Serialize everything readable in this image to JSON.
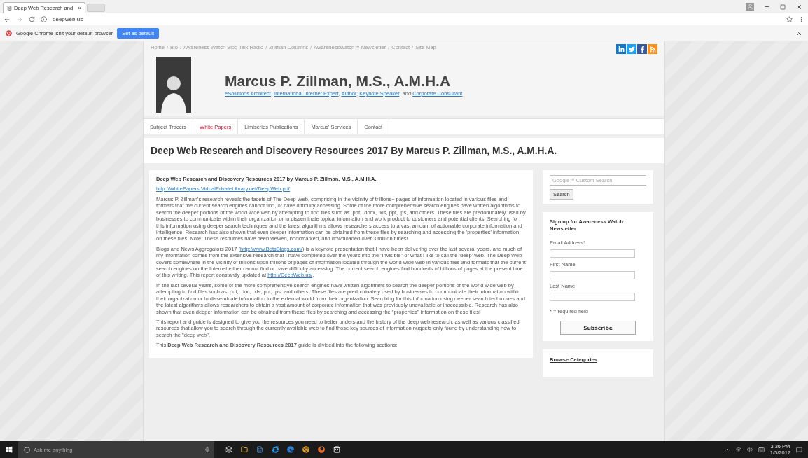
{
  "browser": {
    "tabs": [
      {
        "title": "Deep Web Research and",
        "close": "×",
        "selected": true
      }
    ],
    "address": "deepweb.us",
    "infobar": {
      "message": "Google Chrome isn't your default browser",
      "button": "Set as default"
    }
  },
  "site": {
    "top_links": {
      "separator": "/",
      "items": [
        "Home",
        "Bio",
        "Awareness Watch Blog Talk Radio",
        "Zillman Columns",
        "AwarenessWatch™ Newsletter",
        "Contact",
        "Site Map"
      ]
    },
    "name": "Marcus P. Zillman, M.S., A.M.H.A",
    "tagline": [
      {
        "kind": "link",
        "text": "eSolutions Architect"
      },
      {
        "kind": "text",
        "text": ", "
      },
      {
        "kind": "link",
        "text": "International Internet Expert"
      },
      {
        "kind": "text",
        "text": ", "
      },
      {
        "kind": "link",
        "text": "Author"
      },
      {
        "kind": "text",
        "text": ", "
      },
      {
        "kind": "link",
        "text": "Keynote Speaker"
      },
      {
        "kind": "text",
        "text": ", and "
      },
      {
        "kind": "link",
        "text": "Corporate Consultant"
      }
    ],
    "nav": [
      {
        "label": "Subject Tracers",
        "selected": false
      },
      {
        "label": "White Papers",
        "selected": true
      },
      {
        "label": "Limiseries Publications",
        "selected": false
      },
      {
        "label": "Marcus' Services",
        "selected": false
      },
      {
        "label": "Contact",
        "selected": false
      }
    ],
    "page_title": "Deep Web Research and Discovery Resources 2017 By Marcus P. Zillman, M.S., A.M.H.A."
  },
  "article": {
    "heading": "Deep Web Research and Discovery Resources 2017 by Marcus P. Zillman, M.S., A.M.H.A.",
    "link": "http://WhitePapers.VirtualPrivateLibrary.net/DeepWeb.pdf",
    "paragraphs": [
      [
        {
          "kind": "text",
          "text": "Marcus P. Zillman's research reveals the facets of The Deep Web, comprising in the  vicinity of trillions+ pages of information located in various files and formats that the current search engines cannot find, or have difficulty accessing. Some of the more comprehensive search engines have written algorithms to search the deeper portions of the world wide web by attempting to find files such as .pdf, .docx, .xls, ppt, .ps, and others. These files are predominately used by businesses to communicate within their organization or to disseminate topical information and work product to customers and potential clients. Searching for this information using deeper search techniques and the latest algorithms allows researchers access to a vast amount of actionable corporate information and intelligence. Research has also shown that even deeper information can be obtained from these files by searching and accessing the 'properties' information on these files.  Note: These resources have been viewed, bookmarked, and downloaded over 3 million times!"
        }
      ],
      [
        {
          "kind": "text",
          "text": "Blogs and News Aggregators 2017 ("
        },
        {
          "kind": "link",
          "text": "http://www.BotsBlogs.com/"
        },
        {
          "kind": "text",
          "text": ") is a keynote presentation that I have been delivering over the last several years, and much of my information comes from the extensive research that I have completed over the years into the \"invisible\" or what I like to call the 'deep' web. The Deep Web covers somewhere in the vicinity of trillions upon trillions of pages of information located through the world wide web in various files and formats that the current search engines on the Internet either cannot find or have difficulty accessing. The current search engines find hundreds of billions of pages at the present time of this writing.  This report constantly updated at "
        },
        {
          "kind": "link",
          "text": "http://DeepWeb.us/"
        },
        {
          "kind": "text",
          "text": "."
        }
      ],
      [
        {
          "kind": "text",
          "text": "In the last several years, some of the more comprehensive search engines have written algorithms to search the deeper portions of the world wide web by attempting to find files such as .pdf, .doc, .xls, ppt, .ps. and others.  These files are predominately used by businesses to communicate their information within their organization or to disseminate information to the external world from their organization. Searching for this information using deeper search techniques and the latest algorithms allows researchers to obtain a vast amount of corporate information that was previously unavailable or inaccessible. Research has also shown that even deeper information can be obtained from these files by searching and accessing the \"properties\" information on these files!"
        }
      ],
      [
        {
          "kind": "text",
          "text": "This report and guide is designed to give you the resources you need to better understand the history of the deep web research, as well as various classified resources that allow you to search through the currently available web to find those key sources of information nuggets only found by understanding how to search the \"deep web\"."
        }
      ],
      [
        {
          "kind": "text",
          "text": "This **Deep Web Research and Discovery Resources 2017** guide is divided into the following sections:"
        }
      ]
    ]
  },
  "sidebar": {
    "search": {
      "placeholder": "Google™ Custom Search",
      "button": "Search"
    },
    "newsletter": {
      "title": "Sign up for Awareness Watch Newsletter",
      "fields": [
        {
          "label": "Email Address*"
        },
        {
          "label": "First Name"
        },
        {
          "label": "Last Name"
        }
      ],
      "note": "* = required field",
      "button": "Subscribe"
    },
    "categories_title": "Browse Categories"
  },
  "taskbar": {
    "search_placeholder": "Ask me anything",
    "time": "3:36 PM",
    "date": "1/5/2017"
  }
}
